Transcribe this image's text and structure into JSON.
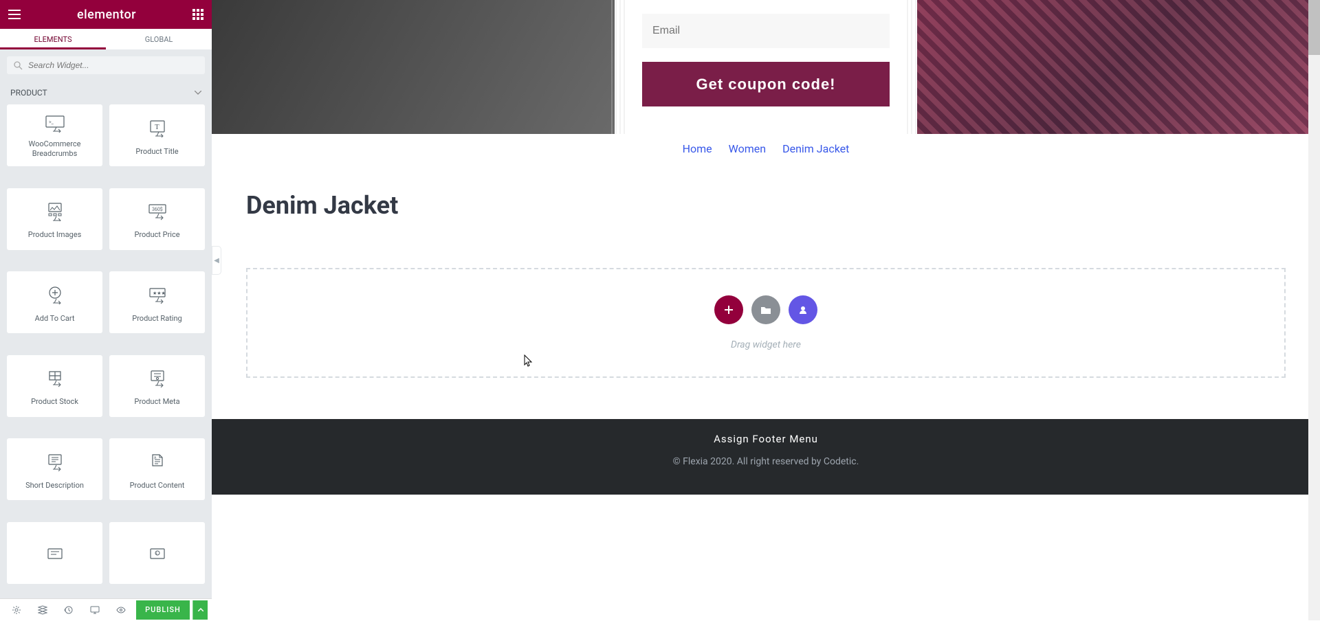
{
  "header": {
    "logo": "elementor"
  },
  "tabs": {
    "elements": "ELEMENTS",
    "global": "GLOBAL"
  },
  "search": {
    "placeholder": "Search Widget..."
  },
  "category": {
    "label": "PRODUCT"
  },
  "widgets": [
    {
      "name": "woocommerce-breadcrumbs",
      "label": "WooCommerce Breadcrumbs"
    },
    {
      "name": "product-title",
      "label": "Product Title"
    },
    {
      "name": "product-images",
      "label": "Product Images"
    },
    {
      "name": "product-price",
      "label": "Product Price"
    },
    {
      "name": "add-to-cart",
      "label": "Add To Cart"
    },
    {
      "name": "product-rating",
      "label": "Product Rating"
    },
    {
      "name": "product-stock",
      "label": "Product Stock"
    },
    {
      "name": "product-meta",
      "label": "Product Meta"
    },
    {
      "name": "short-description",
      "label": "Short Description"
    },
    {
      "name": "product-content",
      "label": "Product Content"
    }
  ],
  "footer_bar": {
    "publish": "PUBLISH"
  },
  "canvas": {
    "email_placeholder": "Email",
    "coupon_button": "Get coupon code!",
    "breadcrumb": [
      "Home",
      "Women",
      "Denim Jacket"
    ],
    "title": "Denim Jacket",
    "drop_text": "Drag widget here"
  },
  "page_footer": {
    "menu": "Assign Footer Menu",
    "copyright": "© Flexia 2020. All right reserved by Codetic."
  }
}
